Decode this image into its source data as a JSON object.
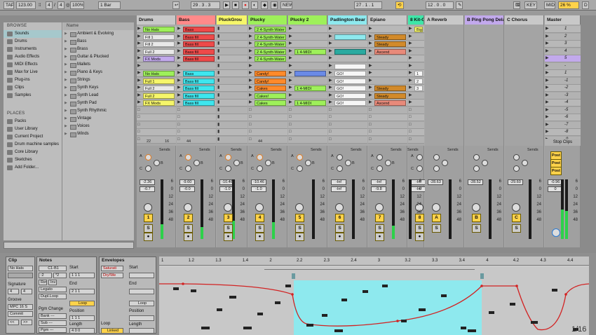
{
  "transport": {
    "tap": "TAP",
    "tempo": "123.00",
    "time_sig_num": "4",
    "time_sig_den": "4",
    "zoom": "100%",
    "quant": "1 Bar",
    "position": "29 . 3 . 3",
    "new": "NEW",
    "loop_start": "27 . 1 . 1",
    "loop_len": "12 . 0 . 0",
    "key": "KEY",
    "midi": "MIDI",
    "cpu": "26 %",
    "disk": "D"
  },
  "browser": {
    "places_header": "BROWSE",
    "categories": [
      "Sounds",
      "Drums",
      "Instruments",
      "Audio Effects",
      "MIDI Effects",
      "Max for Live",
      "Plug-ins",
      "Clips",
      "Samples"
    ],
    "places_title": "PLACES",
    "places": [
      "Packs",
      "User Library",
      "Current Project",
      "Drum machine samples",
      "Core Library",
      "Sketches",
      "Add Folder..."
    ],
    "name_header": "Name",
    "folders": [
      "Ambient & Evolving",
      "Bass",
      "Brass",
      "Guitar & Plucked",
      "Mallets",
      "Piano & Keys",
      "Strings",
      "Synth Keys",
      "Synth Lead",
      "Synth Pad",
      "Synth Rhythmic",
      "Vintage",
      "Voices",
      "Winds"
    ]
  },
  "tracks": [
    {
      "name": "Drums",
      "color": "#c8c8c8",
      "clips": [
        "No Hats",
        "Fill 1",
        "Fill 2",
        "Full 2",
        "FX Mods",
        "",
        "No Hats",
        "Full 1",
        "Full 2",
        "Full 2",
        "FX Mods"
      ],
      "clip_colors": [
        "#9ef05a",
        "#e8e8e8",
        "#e8e8e8",
        "#e8e8e8",
        "#c2a9ec",
        "",
        "#9ef05a",
        "#f6f66a",
        "#e8e8e8",
        "#f6f66a",
        "#f6f66a"
      ],
      "num": "22",
      "num2": "16",
      "vol": "-2.36",
      "pan": "-0.7",
      "btn": "1",
      "meter": 0.25
    },
    {
      "name": "Bass",
      "color": "#ff8a8a",
      "clips": [
        "Bass",
        "Bass fill",
        "Bass fill",
        "Bass fill",
        "Bass fill",
        "",
        "Bass",
        "Bass fill",
        "Bass fill",
        "Bass fill",
        "Bass fill"
      ],
      "clip_colors": [
        "#ee4a4a",
        "#ee4a4a",
        "#ee4a4a",
        "#ee4a4a",
        "#ee4a4a",
        "",
        "#3ee6ee",
        "#3ee6ee",
        "#3ee6ee",
        "#3ee6ee",
        "#3ee6ee"
      ],
      "num": "44",
      "num2": "",
      "vol": "-9.60",
      "pan": "-0.0",
      "btn": "2",
      "meter": 0.2
    },
    {
      "name": "PluckGrou",
      "color": "#f6f66a",
      "clips": [
        "",
        "",
        "",
        "",
        "",
        "",
        "",
        "",
        "",
        "",
        ""
      ],
      "clip_colors": [],
      "num": "",
      "num2": "",
      "vol": "-10.46",
      "pan": "-1.0",
      "btn": "3",
      "meter": 0.3
    },
    {
      "name": "Plucky",
      "color": "#9ef05a",
      "clips": [
        "2 4-Synth-Water",
        "2 4-Synth-Water",
        "2 4-Synth-Water",
        "2 4-Synth-Water",
        "2 4-Synth-Water",
        "",
        "Candy!",
        "Candy!",
        "Cakes",
        "Cakes!",
        "Cakes"
      ],
      "clip_colors": [
        "#9ef05a",
        "#9ef05a",
        "#9ef05a",
        "#9ef05a",
        "#9ef05a",
        "",
        "#ff8a2a",
        "#ff8a2a",
        "#ff8a2a",
        "#9ef05a",
        "#9ef05a"
      ],
      "num": "44",
      "num2": "",
      "vol": "-10.46",
      "pan": "-1.0",
      "btn": "4",
      "meter": 0.28
    },
    {
      "name": "Plucky 2",
      "color": "#9ef05a",
      "clips": [
        "",
        "",
        "",
        "1 4-MIDI",
        "",
        "",
        "",
        "",
        "1 4-MIDI",
        "",
        "1 4-MIDI"
      ],
      "clip_colors": [
        "",
        "",
        "",
        "#9ef05a",
        "",
        "",
        "#6a8ae6",
        "",
        "#9ef05a",
        "",
        "#9ef05a"
      ],
      "num": "",
      "num2": "",
      "vol": "",
      "pan": "",
      "btn": "5",
      "meter": 0
    },
    {
      "name": "Padlington Bear",
      "color": "#8ee9ee",
      "clips": [
        "",
        "",
        "",
        "",
        "",
        "",
        "GO!",
        "GO!",
        "GO!",
        "GO!",
        "GO!"
      ],
      "clip_colors": [
        "",
        "#8ee9ee",
        "",
        "#2aaaa0",
        "",
        "#f6f6f6",
        "#f6f6f6",
        "#f6f6f6",
        "#f6f6f6",
        "#f6f6f6",
        "#f6f6f6"
      ],
      "num": "",
      "num2": "",
      "vol": "-Inf",
      "pan": "-Inf",
      "btn": "6",
      "meter": 0
    },
    {
      "name": "Epiano",
      "color": "#c8c8c8",
      "clips": [
        "",
        "Steady",
        "Steady",
        "Ascend",
        "",
        "",
        "",
        "",
        "Steady",
        "Steady",
        "Ascend"
      ],
      "clip_colors": [
        "",
        "#d28a2a",
        "#d28a2a",
        "#e88a7a",
        "",
        "",
        "",
        "",
        "#d28a2a",
        "#d28a2a",
        "#e88a7a"
      ],
      "num": "",
      "num2": "",
      "vol": "-Inf",
      "pan": "-9.8",
      "btn": "7",
      "meter": 0.22
    },
    {
      "name": "8 Kit-C",
      "color": "#3ee6a8",
      "clips": [
        "Big",
        "",
        "",
        "",
        "",
        "",
        "1",
        "2",
        "3",
        "",
        ""
      ],
      "clip_colors": [
        "#f6f66a",
        "",
        "",
        "",
        "",
        "",
        "#f6f6f6",
        "#f6f6f6",
        "#f6f6f6",
        "",
        ""
      ],
      "num": "",
      "num2": "",
      "vol": "-Inf",
      "pan": "-Inf",
      "btn": "8",
      "meter": 0
    }
  ],
  "returns": [
    {
      "name": "A Reverb",
      "color": "#c8c8c8",
      "vol": "-28.63",
      "btn": "A"
    },
    {
      "name": "B Ping Pong Delay",
      "color": "#c2a9ec",
      "vol": "-28.52",
      "btn": "B"
    },
    {
      "name": "C Chorus",
      "color": "#c8c8c8",
      "vol": "-29.60",
      "btn": "C"
    }
  ],
  "master": {
    "name": "Master",
    "scenes": [
      "1",
      "2",
      "3",
      "4",
      "5",
      "-",
      "1",
      "-1",
      "-2",
      "-3",
      "-4",
      "-5",
      "-6",
      "-7",
      "-8",
      "-9"
    ],
    "stop": "Stop Clips",
    "vol": "-0.96",
    "pan": "0",
    "post": "Post"
  },
  "mixer": {
    "sends": "Sends",
    "knob_a": "A",
    "knob_b": "B",
    "knob_c": "C",
    "scale": [
      "6",
      "0",
      "12",
      "24",
      "36",
      "48"
    ]
  },
  "clip_panel": {
    "title": "Clip",
    "name": "No Hats",
    "sig_label": "Signature",
    "sig_num": "4",
    "sig_den": "4",
    "groove_label": "Groove",
    "groove": "MPC 16 S",
    "commit": "Commit"
  },
  "notes_panel": {
    "title": "Notes",
    "note": "C1-B1",
    "start_label": "Start",
    "start": "1 1 1",
    "end_label": "End",
    "end": "2 1 1",
    "loop_btn": "Loop",
    "pos_label": "Position",
    "pos": "1 1 1",
    "len_label": "Length",
    "len": "4 0 0",
    "pgm_label": "Pgm Change",
    "bank": "Bank ---",
    "sub": "Sub ---",
    "pgm": "Pgm ---",
    "rev": "Rev",
    "inv": "Inv",
    "legato": "Legato",
    "dupl": "Dupl.Loop",
    "div": ":2",
    "mul": "*2"
  },
  "env_panel": {
    "title": "Envelopes",
    "device": "Saturati",
    "param": "Dry/We",
    "start_label": "Start",
    "end_label": "End",
    "loop_btn": "Loop",
    "pos_label": "Position",
    "len_label": "Length",
    "loop_label": "Loop",
    "linked": "Linked"
  },
  "editor": {
    "ruler": [
      "1",
      "1.2",
      "1.3",
      "1.4",
      "2",
      "2.2",
      "2.3",
      "2.4",
      "3",
      "3.2",
      "3.3",
      "3.4",
      "4",
      "4.2",
      "4.3",
      "4.4"
    ],
    "quant": "1/16",
    "loop_color": "#8ee9ee",
    "env_color": "#d22222"
  }
}
